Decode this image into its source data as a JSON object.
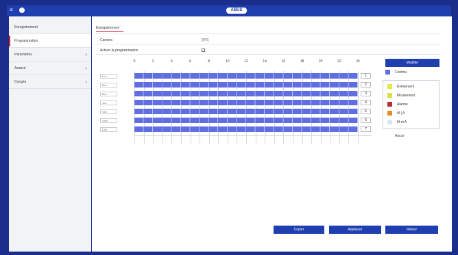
{
  "header": {
    "logo": "ABUS"
  },
  "sidebar": {
    "items": [
      {
        "label": "Enregistrement",
        "chevron": false
      },
      {
        "label": "Programmation",
        "chevron": false,
        "active": true
      },
      {
        "label": "Paramètres",
        "chevron": true
      },
      {
        "label": "Avancé",
        "chevron": true
      },
      {
        "label": "Congés",
        "chevron": true
      }
    ]
  },
  "main": {
    "tab": "Enregistrement",
    "camera_label": "Caméra",
    "camera_value": "[IP2]",
    "enable_label": "Activer la programmation",
    "enable_checked": true
  },
  "schedule": {
    "hours": [
      "0",
      "2",
      "4",
      "6",
      "8",
      "10",
      "12",
      "14",
      "16",
      "18",
      "20",
      "22",
      "24"
    ],
    "days": [
      {
        "name": "Lun",
        "index": "1"
      },
      {
        "name": "Mar",
        "index": "2"
      },
      {
        "name": "Mer",
        "index": "3"
      },
      {
        "name": "Jeu",
        "index": "4"
      },
      {
        "name": "Ven",
        "index": "5"
      },
      {
        "name": "Sam",
        "index": "6"
      },
      {
        "name": "Dim",
        "index": "7"
      }
    ],
    "fill_fraction": 1.0
  },
  "legend": {
    "modify_label": "Modifier",
    "solid": {
      "label": "Continu",
      "color": "#5f6ee0"
    },
    "items": [
      {
        "label": "Événement",
        "color": "#e6e84a"
      },
      {
        "label": "Mouvement",
        "color": "#d8e23a"
      },
      {
        "label": "Alarme",
        "color": "#b23036"
      },
      {
        "label": "M | A",
        "color": "#e08a2a"
      },
      {
        "label": "M et A",
        "color": "#d8e6f2"
      }
    ],
    "erase_label": "Aucun"
  },
  "footer": {
    "copy_label": "Copier",
    "apply_label": "Appliquer",
    "back_label": "Retour"
  },
  "colors": {
    "accent": "#1f3fb0",
    "frame": "#1b2e8c",
    "active_marker": "#d21f2b"
  }
}
